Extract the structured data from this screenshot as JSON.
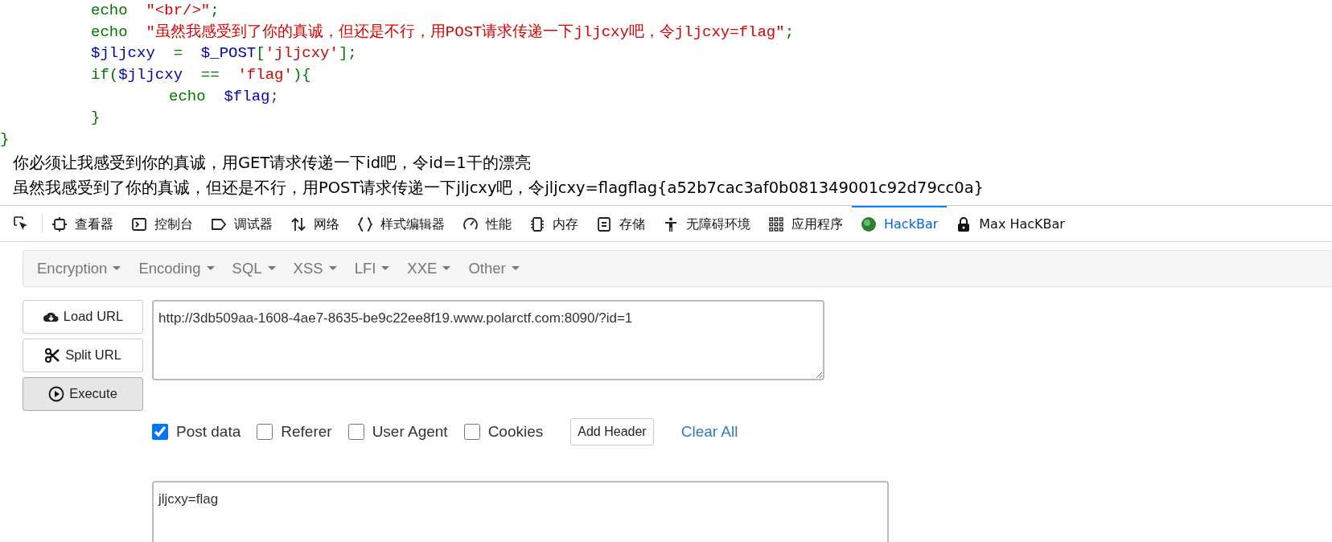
{
  "code_lines": [
    {
      "children": [
        {
          "tokens": [
            {
              "text": "echo  ",
              "kind": "keyword"
            },
            {
              "text": "\"<br/>\"",
              "kind": "string"
            },
            {
              "text": ";",
              "kind": "keyword"
            }
          ]
        },
        {
          "tokens": [
            {
              "text": "echo  ",
              "kind": "keyword"
            },
            {
              "text": "\"虽然我感受到了你的真诚，但还是不行，用POST请求传递一下jljcxy吧，令jljcxy=flag\"",
              "kind": "string"
            },
            {
              "text": ";",
              "kind": "keyword"
            }
          ]
        },
        {
          "tokens": [
            {
              "text": "$jljcxy  ",
              "kind": "variable"
            },
            {
              "text": "=  ",
              "kind": "keyword"
            },
            {
              "text": "$_POST",
              "kind": "variable"
            },
            {
              "text": "[",
              "kind": "keyword"
            },
            {
              "text": "'jljcxy'",
              "kind": "string"
            },
            {
              "text": "];",
              "kind": "keyword"
            }
          ]
        },
        {
          "tokens": [
            {
              "text": "if(",
              "kind": "keyword"
            },
            {
              "text": "$jljcxy  ",
              "kind": "variable"
            },
            {
              "text": "==  ",
              "kind": "keyword"
            },
            {
              "text": "'flag'",
              "kind": "string"
            },
            {
              "text": "){",
              "kind": "keyword"
            }
          ],
          "children": [
            {
              "tokens": [
                {
                  "text": "echo  ",
                  "kind": "keyword"
                },
                {
                  "text": "$flag",
                  "kind": "variable"
                },
                {
                  "text": ";",
                  "kind": "keyword"
                }
              ]
            }
          ]
        },
        {
          "tokens": [
            {
              "text": "}",
              "kind": "keyword"
            }
          ]
        }
      ]
    },
    {
      "tokens": [
        {
          "text": "}",
          "kind": "keyword"
        }
      ]
    }
  ],
  "output_lines": [
    "你必须让我感受到你的真诚，用GET请求传递一下id吧，令id=1干的漂亮",
    "虽然我感受到了你的真诚，但还是不行，用POST请求传递一下jljcxy吧，令jljcxy=flagflag{a52b7cac3af0b081349001c92d79cc0a}"
  ],
  "devtools_tabs": [
    {
      "label": "查看器",
      "selected": false
    },
    {
      "label": "控制台",
      "selected": false
    },
    {
      "label": "调试器",
      "selected": false
    },
    {
      "label": "网络",
      "selected": false
    },
    {
      "label": "样式编辑器",
      "selected": false
    },
    {
      "label": "性能",
      "selected": false
    },
    {
      "label": "内存",
      "selected": false
    },
    {
      "label": "存储",
      "selected": false
    },
    {
      "label": "无障碍环境",
      "selected": false
    },
    {
      "label": "应用程序",
      "selected": false
    },
    {
      "label": "HackBar",
      "selected": true
    },
    {
      "label": "Max HacKBar",
      "selected": false
    }
  ],
  "hackbar": {
    "menus": [
      "Encryption",
      "Encoding",
      "SQL",
      "XSS",
      "LFI",
      "XXE",
      "Other"
    ],
    "buttons": [
      {
        "label": "Load URL",
        "pressed": false
      },
      {
        "label": "Split URL",
        "pressed": false
      },
      {
        "label": "Execute",
        "pressed": true
      }
    ],
    "url": "http://3db509aa-1608-4ae7-8635-be9c22ee8f19.www.polarctf.com:8090/?id=1",
    "options": [
      {
        "label": "Post data",
        "checked": true
      },
      {
        "label": "Referer",
        "checked": false
      },
      {
        "label": "User Agent",
        "checked": false
      },
      {
        "label": "Cookies",
        "checked": false
      }
    ],
    "add_header": "Add Header",
    "clear_all": "Clear All",
    "post_data": "jljcxy=flag"
  }
}
